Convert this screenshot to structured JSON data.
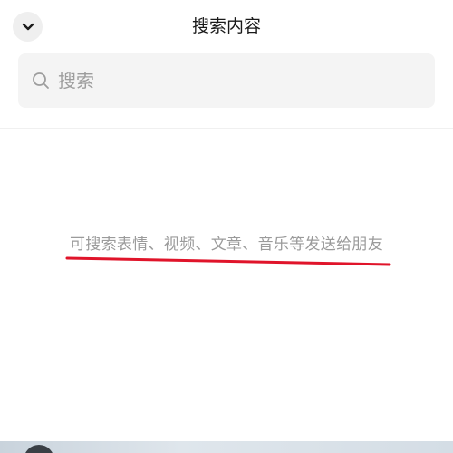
{
  "header": {
    "title": "搜索内容",
    "back_icon": "chevron-down-icon"
  },
  "search": {
    "placeholder": "搜索",
    "value": "",
    "icon": "search-icon"
  },
  "hint": {
    "text": "可搜索表情、视频、文章、音乐等发送给朋友",
    "underline_color": "#e0142a"
  }
}
